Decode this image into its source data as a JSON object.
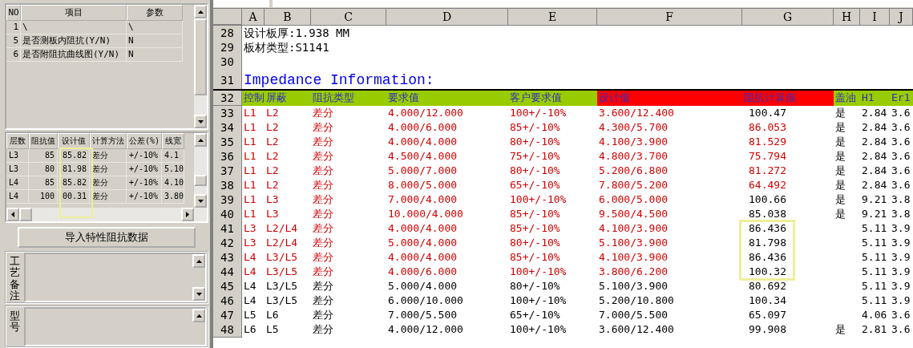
{
  "left_panel": {
    "parameter_grid": {
      "columns": [
        "NO",
        "项目",
        "参数"
      ],
      "rows": [
        [
          "1",
          "\\",
          "\\"
        ],
        [
          "5",
          "是否测板内阻抗(Y/N)",
          "N"
        ],
        [
          "6",
          "是否附阻抗曲线图(Y/N)",
          "N"
        ]
      ]
    },
    "layer_grid": {
      "columns": [
        "层数",
        "阻抗值",
        "设计值",
        "计算方法",
        "公差(%)",
        "线宽"
      ],
      "rows": [
        [
          "L3",
          "85",
          "85.82",
          "差分",
          "+/-10%",
          "4.1"
        ],
        [
          "L3",
          "80",
          "81.98",
          "差分",
          "+/-10%",
          "5.10"
        ],
        [
          "L4",
          "85",
          "85.82",
          "差分",
          "+/-10%",
          "4.10"
        ],
        [
          "L4",
          "100",
          "00.31",
          "差分",
          "+/-10%",
          "3.80"
        ]
      ]
    },
    "import_button": "导入特性阻抗数据",
    "memos": [
      {
        "label": "工艺备注"
      },
      {
        "label": "型号"
      }
    ]
  },
  "sheet": {
    "column_letters": [
      "A",
      "B",
      "C",
      "D",
      "E",
      "F",
      "G",
      "H",
      "I",
      "J"
    ],
    "lines": [
      {
        "row": "28",
        "kind": "note",
        "text": "设计板厚:1.938 MM"
      },
      {
        "row": "29",
        "kind": "note",
        "text": "板材类型:S1141"
      },
      {
        "row": "30",
        "kind": "blank"
      },
      {
        "row": "31",
        "kind": "title",
        "text": "Impedance Information:"
      }
    ],
    "header": {
      "row": "32",
      "cells": [
        {
          "text": "控制",
          "color": "#99cc00"
        },
        {
          "text": "屏蔽",
          "color": "#99cc00"
        },
        {
          "text": "阻抗类型",
          "color": "#99cc00"
        },
        {
          "text": "要求值",
          "color": "#99cc00"
        },
        {
          "text": "客户要求值",
          "color": "#99cc00"
        },
        {
          "text": "设计值",
          "color": "#ff0000"
        },
        {
          "text": "阻抗计算值",
          "color": "#ff0000"
        },
        {
          "text": "盖油",
          "color": "#99cc00"
        },
        {
          "text": "H1",
          "color": "#99cc00"
        },
        {
          "text": "Er1",
          "color": "#99cc00"
        }
      ]
    },
    "rows": [
      {
        "n": "33",
        "flagged": true,
        "calc_flagged": false,
        "cells": [
          "L1",
          "L2",
          "差分",
          "4.000/12.000",
          "100+/-10%",
          "3.600/12.400",
          "100.47",
          "是",
          "2.84",
          "3.6"
        ]
      },
      {
        "n": "34",
        "flagged": true,
        "calc_flagged": true,
        "cells": [
          "L1",
          "L2",
          "差分",
          "4.000/6.000",
          "85+/-10%",
          "4.300/5.700",
          "86.053",
          "是",
          "2.84",
          "3.6"
        ]
      },
      {
        "n": "35",
        "flagged": true,
        "calc_flagged": true,
        "cells": [
          "L1",
          "L2",
          "差分",
          "4.000/4.000",
          "80+/-10%",
          "4.100/3.900",
          "81.529",
          "是",
          "2.84",
          "3.6"
        ]
      },
      {
        "n": "36",
        "flagged": true,
        "calc_flagged": true,
        "cells": [
          "L1",
          "L2",
          "差分",
          "4.500/4.000",
          "75+/-10%",
          "4.800/3.700",
          "75.794",
          "是",
          "2.84",
          "3.6"
        ]
      },
      {
        "n": "37",
        "flagged": true,
        "calc_flagged": true,
        "cells": [
          "L1",
          "L2",
          "差分",
          "5.000/7.000",
          "80+/-10%",
          "5.200/6.800",
          "81.272",
          "是",
          "2.84",
          "3.6"
        ]
      },
      {
        "n": "38",
        "flagged": true,
        "calc_flagged": true,
        "cells": [
          "L1",
          "L2",
          "差分",
          "8.000/5.000",
          "65+/-10%",
          "7.800/5.200",
          "64.492",
          "是",
          "2.84",
          "3.6"
        ]
      },
      {
        "n": "39",
        "flagged": true,
        "calc_flagged": false,
        "cells": [
          "L1",
          "L3",
          "差分",
          "7.000/4.000",
          "100+/-10%",
          "6.000/5.000",
          "100.66",
          "是",
          "9.21",
          "3.8"
        ]
      },
      {
        "n": "40",
        "flagged": true,
        "calc_flagged": false,
        "cells": [
          "L1",
          "L3",
          "差分",
          "10.000/4.000",
          "85+/-10%",
          "9.500/4.500",
          "85.038",
          "是",
          "9.21",
          "3.8"
        ]
      },
      {
        "n": "41",
        "flagged": true,
        "calc_flagged": false,
        "cells": [
          "L3",
          "L2/L4",
          "差分",
          "4.000/4.000",
          "85+/-10%",
          "4.100/3.900",
          "86.436",
          "",
          "5.11",
          "3.9"
        ]
      },
      {
        "n": "42",
        "flagged": true,
        "calc_flagged": false,
        "cells": [
          "L3",
          "L2/L4",
          "差分",
          "5.000/4.000",
          "80+/-10%",
          "5.100/3.900",
          "81.798",
          "",
          "5.11",
          "3.9"
        ]
      },
      {
        "n": "43",
        "flagged": true,
        "calc_flagged": false,
        "cells": [
          "L4",
          "L3/L5",
          "差分",
          "4.000/4.000",
          "85+/-10%",
          "4.100/3.900",
          "86.436",
          "",
          "5.11",
          "3.9"
        ]
      },
      {
        "n": "44",
        "flagged": true,
        "calc_flagged": false,
        "cells": [
          "L4",
          "L3/L5",
          "差分",
          "4.000/6.000",
          "100+/-10%",
          "3.800/6.200",
          "100.32",
          "",
          "5.11",
          "3.9"
        ]
      },
      {
        "n": "45",
        "flagged": false,
        "calc_flagged": false,
        "cells": [
          "L4",
          "L3/L5",
          "差分",
          "5.000/4.000",
          "80+/-10%",
          "5.100/3.900",
          "80.692",
          "",
          "5.11",
          "3.9"
        ]
      },
      {
        "n": "46",
        "flagged": false,
        "calc_flagged": false,
        "cells": [
          "L4",
          "L3/L5",
          "差分",
          "6.000/10.000",
          "100+/-10%",
          "5.200/10.800",
          "100.34",
          "",
          "5.11",
          "3.9"
        ]
      },
      {
        "n": "47",
        "flagged": false,
        "calc_flagged": false,
        "cells": [
          "L5",
          "L6",
          "差分",
          "7.000/5.500",
          "65+/-10%",
          "7.000/5.500",
          "65.097",
          "",
          "4.06",
          "3.6"
        ]
      },
      {
        "n": "48",
        "flagged": false,
        "calc_flagged": false,
        "cells": [
          "L6",
          "L5",
          "差分",
          "4.000/12.000",
          "100+/-10%",
          "3.600/12.400",
          "99.908",
          "是",
          "2.81",
          "3.6"
        ]
      }
    ]
  }
}
